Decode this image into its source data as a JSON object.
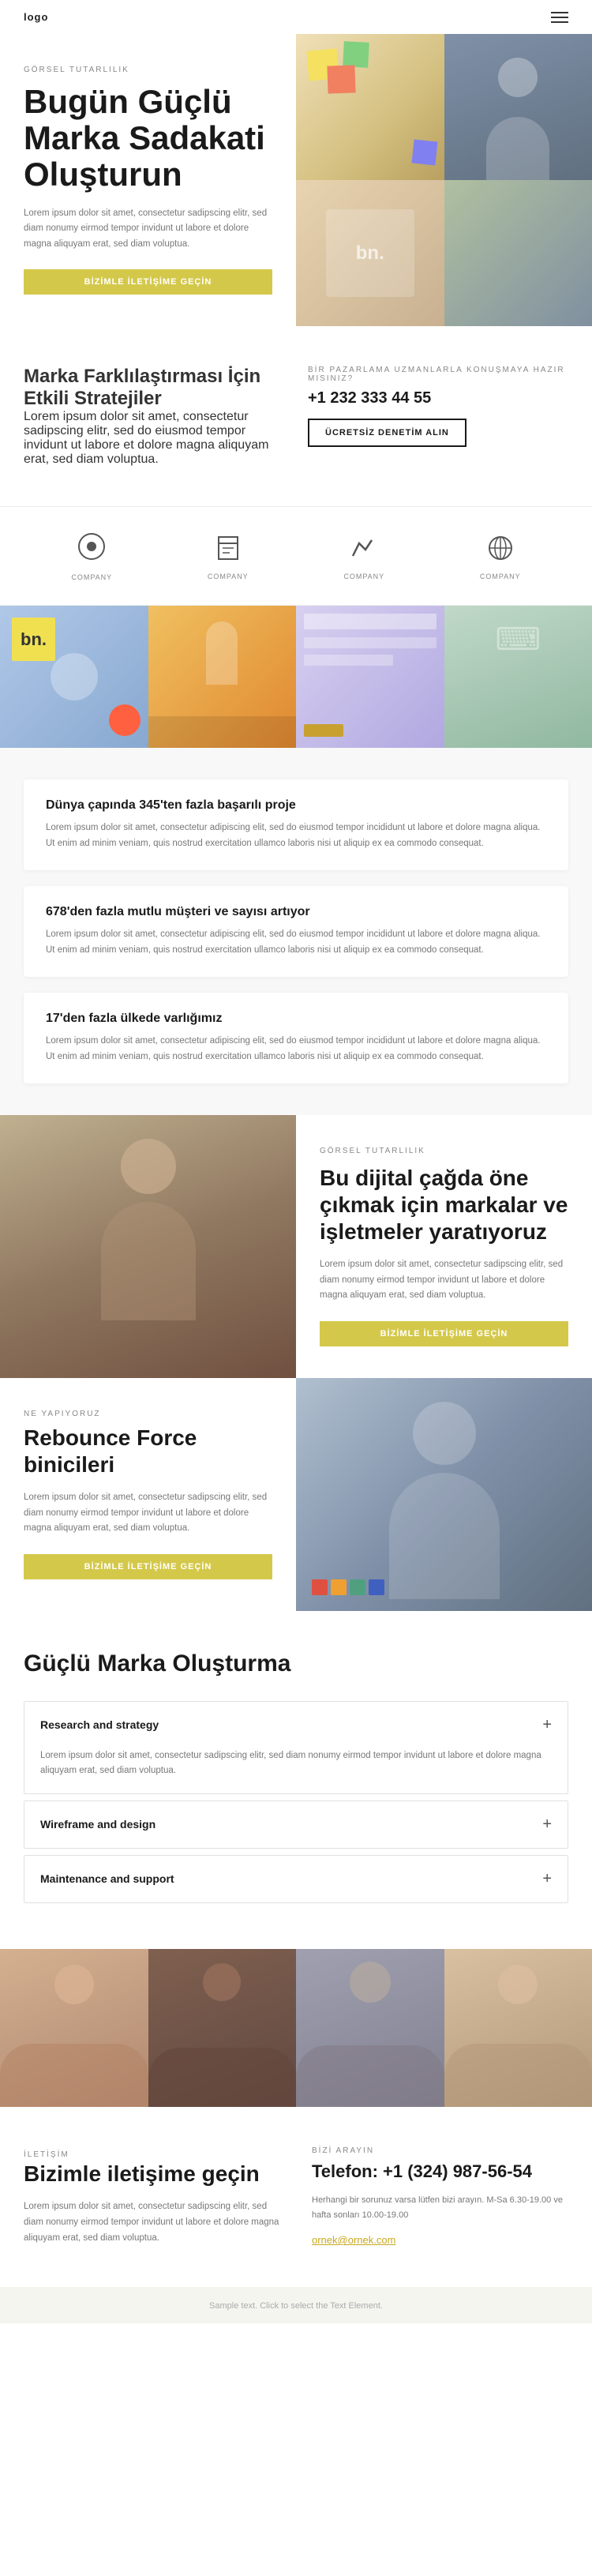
{
  "nav": {
    "logo": "logo",
    "menu_icon": "≡"
  },
  "hero": {
    "tag": "GÖRSEL TUTARLILIK",
    "title": "Bugün Güçlü Marka Sadakati Oluşturun",
    "description": "Lorem ipsum dolor sit amet, consectetur sadipscing elitr, sed diam nonumy eirmod tempor invidunt ut labore et dolore magna aliquyam erat, sed diam voluptua.",
    "cta_button": "BİZİMLE İLETİŞİME GEÇİN"
  },
  "brand_section": {
    "title": "Marka Farklılaştırması İçin Etkili Stratejiler",
    "description": "Lorem ipsum dolor sit amet, consectetur sadipscing elitr, sed do eiusmod tempor invidunt ut labore et dolore magna aliquyam erat, sed diam voluptua.",
    "right_tag": "BİR PAZARLAMA UZMANLARLA KONUŞMAYA HAZIR MISINIZ?",
    "phone": "+1 232 333 44 55",
    "cta_button": "ÜCRETSİZ DENETİM ALIN"
  },
  "logos": [
    {
      "label": "COMPANY"
    },
    {
      "label": "COMPANY"
    },
    {
      "label": "COMPANY"
    },
    {
      "label": "COMPANY"
    }
  ],
  "stats": [
    {
      "title": "Dünya çapında 345'ten fazla başarılı proje",
      "description": "Lorem ipsum dolor sit amet, consectetur adipiscing elit, sed do eiusmod tempor incididunt ut labore et dolore magna aliqua. Ut enim ad minim veniam, quis nostrud exercitation ullamco laboris nisi ut aliquip ex ea commodo consequat."
    },
    {
      "title": "678'den fazla mutlu müşteri ve sayısı artıyor",
      "description": "Lorem ipsum dolor sit amet, consectetur adipiscing elit, sed do eiusmod tempor incididunt ut labore et dolore magna aliqua. Ut enim ad minim veniam, quis nostrud exercitation ullamco laboris nisi ut aliquip ex ea commodo consequat."
    },
    {
      "title": "17'den fazla ülkede varlığımız",
      "description": "Lorem ipsum dolor sit amet, consectetur adipiscing elit, sed do eiusmod tempor incididunt ut labore et dolore magna aliqua. Ut enim ad minim veniam, quis nostrud exercitation ullamco laboris nisi ut aliquip ex ea commodo consequat."
    }
  ],
  "section_visual2": {
    "tag": "GÖRSEL TUTARLILIK",
    "title": "Bu dijital çağda öne çıkmak için markalar ve işletmeler yaratıyoruz",
    "description": "Lorem ipsum dolor sit amet, consectetur sadipscing elitr, sed diam nonumy eirmod tempor invidunt ut labore et dolore magna aliquyam erat, sed diam voluptua.",
    "cta_button": "BİZİMLE İLETİŞİME GEÇİN"
  },
  "section3": {
    "tag": "NE YAPIYORUZ",
    "title": "Rebounce Force binicileri",
    "description": "Lorem ipsum dolor sit amet, consectetur sadipscing elitr, sed diam nonumy eirmod tempor invidunt ut labore et dolore magna aliquyam erat, sed diam voluptua.",
    "cta_button": "BİZİMLE İLETİŞİME GEÇİN"
  },
  "accordion": {
    "title": "Güçlü Marka Oluşturma",
    "items": [
      {
        "title": "Research and strategy",
        "body": "Lorem ipsum dolor sit amet, consectetur sadipscing elitr, sed diam nonumy eirmod tempor invidunt ut labore et dolore magna aliquyam erat, sed diam voluptua.",
        "open": true
      },
      {
        "title": "Wireframe and design",
        "body": "",
        "open": false
      },
      {
        "title": "Maintenance and support",
        "body": "",
        "open": false
      }
    ]
  },
  "contact": {
    "tag": "İLETİŞİM",
    "title": "Bizimle iletişime geçin",
    "description": "Lorem ipsum dolor sit amet, consectetur sadipscing elitr, sed diam nonumy eirmod tempor invidunt ut labore et dolore magna aliquyam erat, sed diam voluptua.",
    "right_tag": "BİZİ ARAYIN",
    "phone": "Telefon: +1 (324) 987-56-54",
    "hours_label": "Herhangi bir sorunuz varsa lütfen bizi arayın. M-Sa 6.30-19.00 ve hafta sonları 10.00-19.00",
    "email": "ornek@ornek.com"
  },
  "footer": {
    "text": "Sample text. Click to select the Text Element."
  }
}
